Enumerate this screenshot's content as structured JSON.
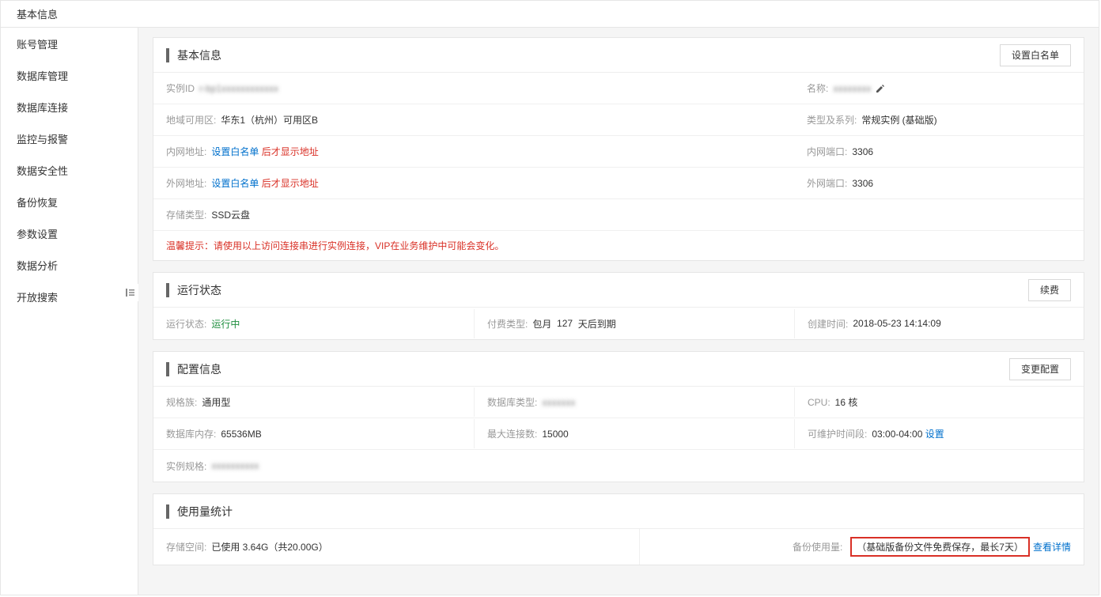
{
  "top_title": "基本信息",
  "sidebar": {
    "items": [
      {
        "label": "账号管理"
      },
      {
        "label": "数据库管理"
      },
      {
        "label": "数据库连接"
      },
      {
        "label": "监控与报警"
      },
      {
        "label": "数据安全性"
      },
      {
        "label": "备份恢复"
      },
      {
        "label": "参数设置"
      },
      {
        "label": "数据分析"
      },
      {
        "label": "开放搜索"
      }
    ]
  },
  "basic": {
    "title": "基本信息",
    "whitelist_btn": "设置白名单",
    "instance_id_label": "实例ID",
    "instance_id_value": "r-bp1xxxxxxxxxxxx",
    "name_label": "名称:",
    "name_value": "xxxxxxxx",
    "region_label": "地域可用区:",
    "region_value": "华东1（杭州）可用区B",
    "type_label": "类型及系列:",
    "type_value": "常规实例 (基础版)",
    "intranet_addr_label": "内网地址:",
    "intranet_port_label": "内网端口:",
    "intranet_port_value": "3306",
    "extranet_addr_label": "外网地址:",
    "extranet_port_label": "外网端口:",
    "extranet_port_value": "3306",
    "set_whitelist_link": "设置白名单",
    "addr_suffix": "后才显示地址",
    "storage_label": "存储类型:",
    "storage_value": "SSD云盘",
    "tip": "温馨提示：请使用以上访问连接串进行实例连接，VIP在业务维护中可能会变化。"
  },
  "status": {
    "title": "运行状态",
    "renew_btn": "续费",
    "status_label": "运行状态:",
    "status_value": "运行中",
    "billing_label": "付费类型:",
    "billing_prefix": "包月",
    "billing_days": "127",
    "billing_suffix": "天后到期",
    "created_label": "创建时间:",
    "created_value": "2018-05-23 14:14:09"
  },
  "config": {
    "title": "配置信息",
    "change_btn": "变更配置",
    "family_label": "规格族:",
    "family_value": "通用型",
    "dbtype_label": "数据库类型:",
    "dbtype_value": "xxxxxxx",
    "cpu_label": "CPU:",
    "cpu_value": "16 核",
    "mem_label": "数据库内存:",
    "mem_value": "65536MB",
    "maxconn_label": "最大连接数:",
    "maxconn_value": "15000",
    "maint_label": "可维护时间段:",
    "maint_value": "03:00-04:00",
    "maint_link": "设置",
    "spec_label": "实例规格:",
    "spec_value": "xxxxxxxxxx"
  },
  "usage": {
    "title": "使用量统计",
    "storage_label": "存储空间:",
    "storage_value": "已使用 3.64G（共20.00G）",
    "backup_label": "备份使用量:",
    "backup_boxed": "（基础版备份文件免费保存，最长7天）",
    "backup_link": "查看详情"
  }
}
